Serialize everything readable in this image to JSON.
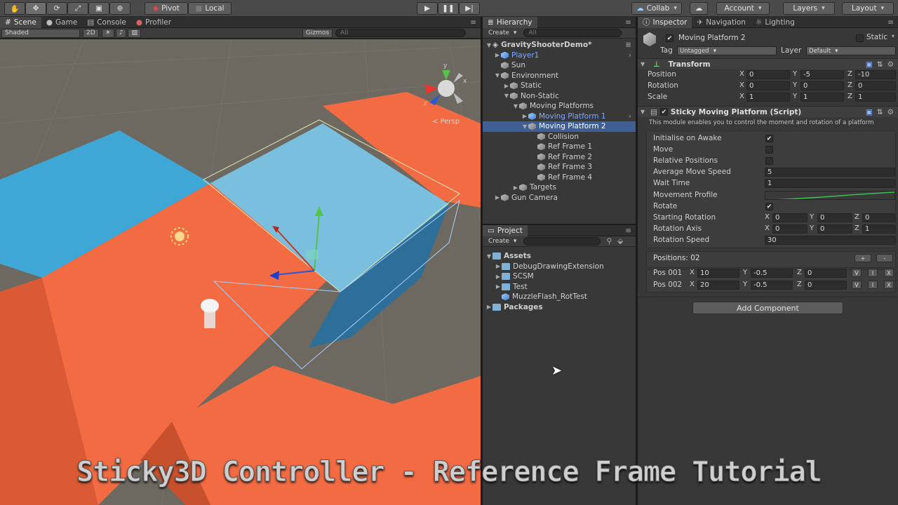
{
  "toolbar": {
    "pivot": "Pivot",
    "local": "Local",
    "collab": "Collab",
    "account": "Account",
    "layers": "Layers",
    "layout": "Layout"
  },
  "scene_tabs": {
    "scene": "Scene",
    "game": "Game",
    "console": "Console",
    "profiler": "Profiler",
    "shaded": "Shaded",
    "two_d": "2D",
    "gizmos": "Gizmos",
    "search_placeholder": "All",
    "persp": "Persp",
    "gizmo_y": "y",
    "gizmo_x": "x",
    "gizmo_z": "z"
  },
  "hierarchy": {
    "title": "Hierarchy",
    "create": "Create",
    "search_placeholder": "All",
    "items": [
      {
        "label": "GravityShooterDemo*",
        "depth": 0
      },
      {
        "label": "Player1",
        "depth": 1
      },
      {
        "label": "Sun",
        "depth": 1
      },
      {
        "label": "Environment",
        "depth": 1
      },
      {
        "label": "Static",
        "depth": 2
      },
      {
        "label": "Non-Static",
        "depth": 2
      },
      {
        "label": "Moving Platforms",
        "depth": 3
      },
      {
        "label": "Moving Platform 1",
        "depth": 4
      },
      {
        "label": "Moving Platform 2",
        "depth": 4
      },
      {
        "label": "Collision",
        "depth": 5
      },
      {
        "label": "Ref Frame 1",
        "depth": 5
      },
      {
        "label": "Ref Frame 2",
        "depth": 5
      },
      {
        "label": "Ref Frame 3",
        "depth": 5
      },
      {
        "label": "Ref Frame 4",
        "depth": 5
      },
      {
        "label": "Targets",
        "depth": 4
      },
      {
        "label": "Gun Camera",
        "depth": 1
      }
    ]
  },
  "project": {
    "title": "Project",
    "create": "Create",
    "items": [
      {
        "label": "Assets"
      },
      {
        "label": "DebugDrawingExtension"
      },
      {
        "label": "SCSM"
      },
      {
        "label": "Test"
      },
      {
        "label": "MuzzleFlash_RotTest"
      },
      {
        "label": "Packages"
      }
    ]
  },
  "inspector": {
    "tabs": [
      "Inspector",
      "Navigation",
      "Lighting"
    ],
    "object_name": "Moving Platform 2",
    "static_label": "Static",
    "tag_label": "Tag",
    "tag_value": "Untagged",
    "layer_label": "Layer",
    "layer_value": "Default",
    "transform": {
      "title": "Transform",
      "rows": [
        {
          "label": "Position",
          "x": "0",
          "y": "-5",
          "z": "-10"
        },
        {
          "label": "Rotation",
          "x": "0",
          "y": "0",
          "z": "0"
        },
        {
          "label": "Scale",
          "x": "1",
          "y": "1",
          "z": "1"
        }
      ]
    },
    "script": {
      "title": "Sticky Moving Platform (Script)",
      "description": "This module enables you to control the moment and rotation of a platform",
      "initialise_label": "Initialise on Awake",
      "move_label": "Move",
      "relative_label": "Relative Positions",
      "speed_label": "Average Move Speed",
      "speed_value": "5",
      "wait_label": "Wait Time",
      "wait_value": "1",
      "profile_label": "Movement Profile",
      "rotate_label": "Rotate",
      "start_rot_label": "Starting Rotation",
      "start_rot": {
        "x": "0",
        "y": "0",
        "z": "0"
      },
      "rot_axis_label": "Rotation Axis",
      "rot_axis": {
        "x": "0",
        "y": "0",
        "z": "1"
      },
      "rot_speed_label": "Rotation Speed",
      "rot_speed_value": "30",
      "positions_label": "Positions: 02",
      "plus": "+",
      "minus": "-",
      "positions": [
        {
          "label": "Pos 001",
          "x": "10",
          "y": "-0.5",
          "z": "0"
        },
        {
          "label": "Pos 002",
          "x": "20",
          "y": "-0.5",
          "z": "0"
        }
      ],
      "btn_v": "V",
      "btn_i": "I",
      "btn_x": "X"
    },
    "add_component": "Add Component"
  },
  "axis_letters": {
    "x": "X",
    "y": "Y",
    "z": "Z"
  },
  "caption": "Sticky3D Controller - Reference Frame Tutorial",
  "colors": {
    "platform_orange": "#f26b43",
    "platform_blue": "#3fa7d6",
    "selection": "#3e5f96",
    "prefab_blue": "#7fa8ff"
  }
}
